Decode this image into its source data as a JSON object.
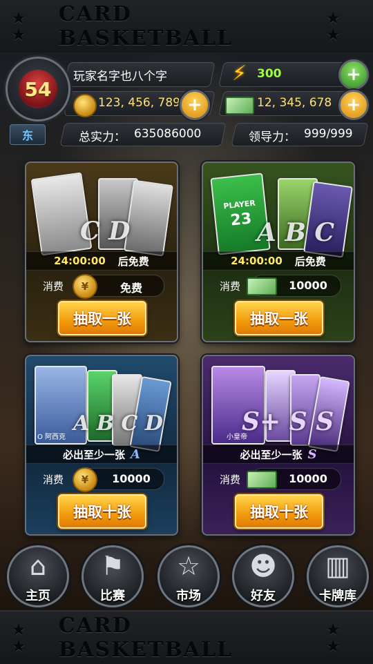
{
  "banner": {
    "title": "CARD BASKETBALL",
    "stars": "★ ★"
  },
  "player": {
    "level": "54",
    "name": "玩家名字也八个字",
    "conference": "东",
    "coins": "123, 456, 789",
    "energy": "300",
    "cash": "12, 345, 678",
    "total_power_label": "总实力：",
    "total_power": "635086000",
    "leadership_label": "领导力：",
    "leadership": "999/999",
    "plus": "+"
  },
  "packs": [
    {
      "letters": "C D",
      "timer": "24:00:00",
      "timer_suffix": "后免费",
      "cost_label": "消费",
      "cost_value": "免费",
      "currency": "coin",
      "button": "抽取一张"
    },
    {
      "letters": "A B C",
      "timer": "24:00:00",
      "timer_suffix": "后免费",
      "cost_label": "消费",
      "cost_value": "10000",
      "currency": "cash",
      "button": "抽取一张",
      "jersey_text": "PLAYER",
      "jersey_number": "23"
    },
    {
      "letters": "A B C D",
      "guarantee": "必出至少一张",
      "rarity": "A",
      "cost_label": "消费",
      "cost_value": "10000",
      "currency": "coin",
      "button": "抽取十张",
      "card_caption": "O 阿西克"
    },
    {
      "letters": "S+ S S",
      "guarantee": "必出至少一张",
      "rarity": "S",
      "cost_label": "消费",
      "cost_value": "10000",
      "currency": "cash",
      "button": "抽取十张",
      "card_caption": "小皇帝"
    }
  ],
  "nav": [
    {
      "label": "主页",
      "icon": "home-icon"
    },
    {
      "label": "比赛",
      "icon": "flag-icon"
    },
    {
      "label": "市场",
      "icon": "star-icon"
    },
    {
      "label": "好友",
      "icon": "friends-icon"
    },
    {
      "label": "卡牌库",
      "icon": "card-library-icon"
    }
  ],
  "colors": {
    "gold_button": "#f29a0c",
    "energy": "#9dff3a",
    "timer": "#ffe86a",
    "conference": "#6fc6ff"
  }
}
